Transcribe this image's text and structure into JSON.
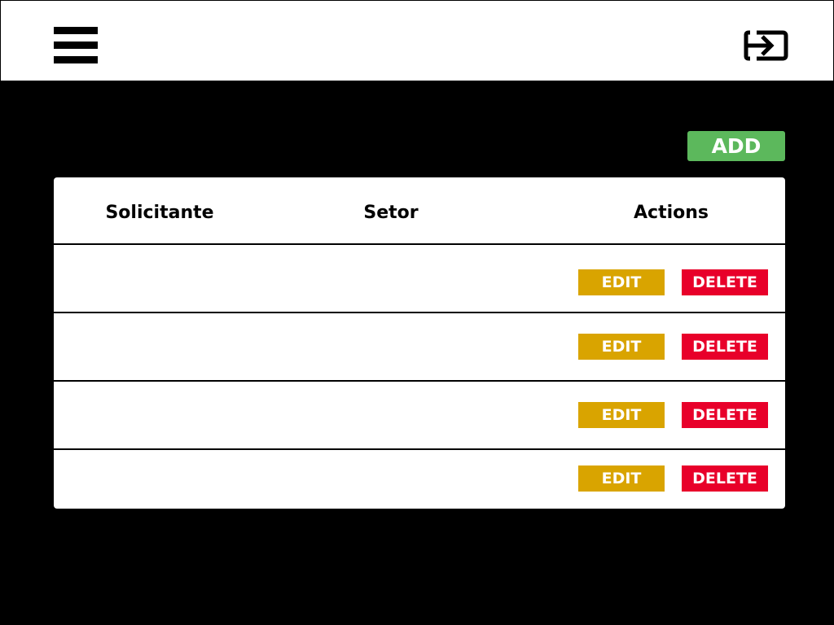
{
  "header": {
    "menu_icon": "hamburger-menu-icon",
    "logout_icon": "logout-icon"
  },
  "toolbar": {
    "add_label": "ADD"
  },
  "table": {
    "columns": [
      "Solicitante",
      "Setor",
      "Actions"
    ],
    "rows": [
      {
        "solicitante": "",
        "setor": "",
        "edit_label": "EDIT",
        "delete_label": "DELETE"
      },
      {
        "solicitante": "",
        "setor": "",
        "edit_label": "EDIT",
        "delete_label": "DELETE"
      },
      {
        "solicitante": "",
        "setor": "",
        "edit_label": "EDIT",
        "delete_label": "DELETE"
      },
      {
        "solicitante": "",
        "setor": "",
        "edit_label": "EDIT",
        "delete_label": "DELETE"
      }
    ]
  },
  "colors": {
    "page_background": "#000000",
    "header_background": "#ffffff",
    "add": "#5cb85c",
    "edit": "#d9a400",
    "delete": "#e8002a"
  }
}
